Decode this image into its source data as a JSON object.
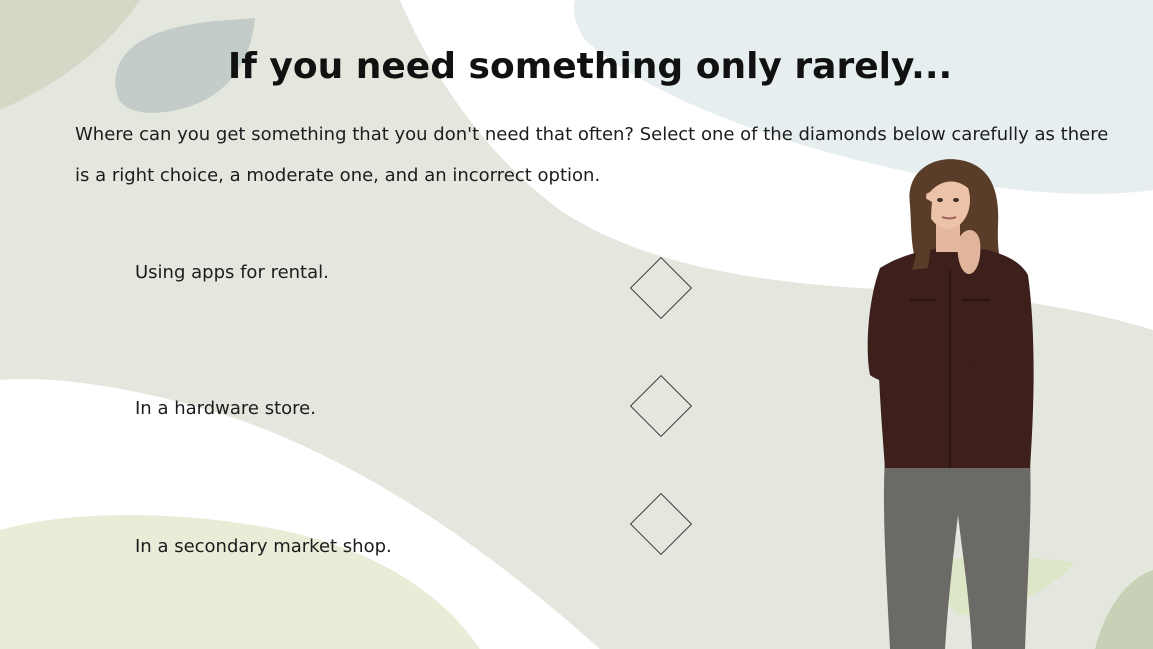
{
  "slide": {
    "title": "If you need something only rarely...",
    "intro": "Where can you get something that you don't need that often? Select one of the diamonds below carefully as there is a right choice, a moderate one, and an incorrect option."
  },
  "options": [
    {
      "label": "Using apps for rental."
    },
    {
      "label": "In a hardware store."
    },
    {
      "label": "In a secondary market shop."
    }
  ],
  "colors": {
    "background": "#ffffff",
    "shape_sage": "#e4e7de",
    "shape_blue": "#e6eef0",
    "shape_olive": "#d4d8c6",
    "leaf_gray": "#c3ccc8",
    "text": "#1c1c1c"
  },
  "icons": {
    "option_marker": "diamond-outline"
  }
}
